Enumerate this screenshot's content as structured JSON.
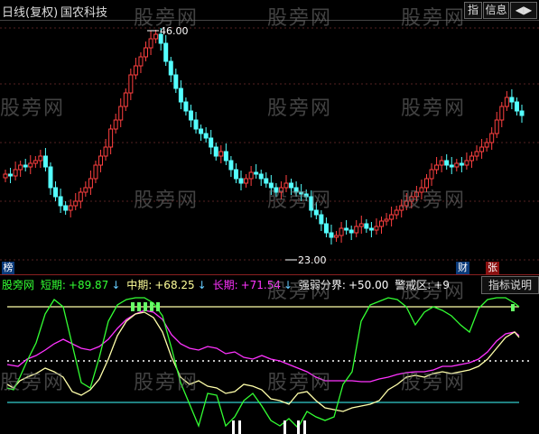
{
  "header": {
    "period": "日线(复权)",
    "stock_name": "国农科技",
    "buttons": [
      "指",
      "信息",
      "◀▶"
    ]
  },
  "watermark": "股旁网",
  "price_chart": {
    "high_label": "46.00",
    "low_label": "23.00",
    "badges": [
      "榜",
      "财",
      "张"
    ]
  },
  "indicator": {
    "name": "股旁网",
    "short_label": "短期:",
    "short_value": "+89.87",
    "mid_label": "中期:",
    "mid_value": "+68.25",
    "long_label": "长期:",
    "long_value": "+71.54",
    "strength_label": "强弱分界:",
    "strength_value": "+50.00",
    "warn_label": "警戒区:",
    "warn_value": "+9",
    "help_button": "指标说明"
  },
  "colors": {
    "up": "#ff4040",
    "down": "#54ffff",
    "short": "#33ff33",
    "mid": "#ffff99",
    "long": "#ff33ff",
    "upper_line": "#ffffaa",
    "lower_line": "#33cccc",
    "arrow": "#66ccff"
  }
}
